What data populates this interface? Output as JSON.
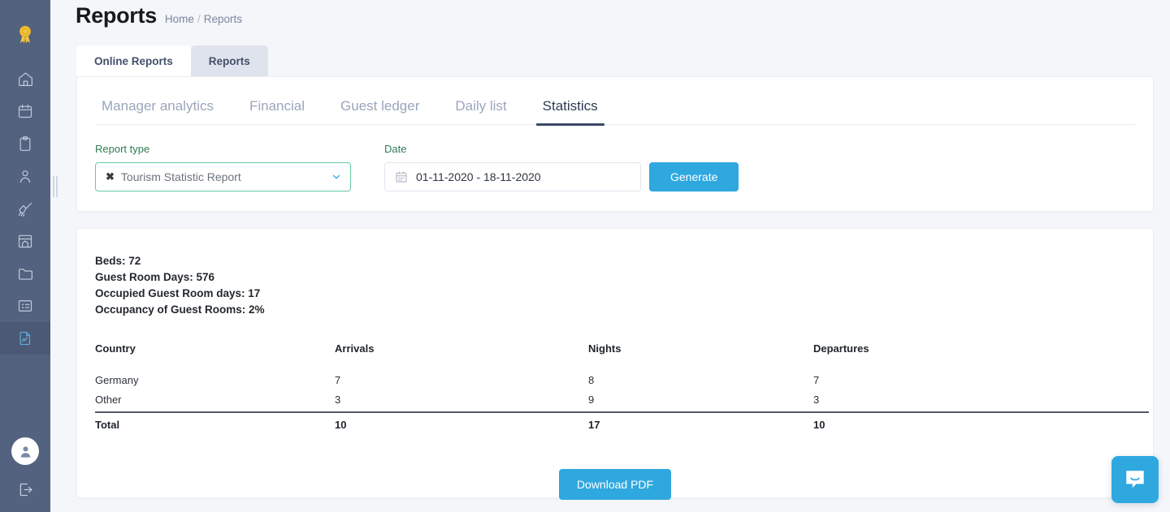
{
  "sidebar": {
    "logo_icon": "award-badge-icon",
    "items": [
      {
        "icon": "home-icon",
        "name": "sidebar-item-home",
        "active": false
      },
      {
        "icon": "calendar-icon",
        "name": "sidebar-item-calendar",
        "active": false
      },
      {
        "icon": "clipboard-icon",
        "name": "sidebar-item-clipboard",
        "active": false
      },
      {
        "icon": "user-icon",
        "name": "sidebar-item-guests",
        "active": false
      },
      {
        "icon": "broom-icon",
        "name": "sidebar-item-housekeeping",
        "active": false
      },
      {
        "icon": "window-icon",
        "name": "sidebar-item-rooms",
        "active": false
      },
      {
        "icon": "folder-icon",
        "name": "sidebar-item-files",
        "active": false
      },
      {
        "icon": "board-icon",
        "name": "sidebar-item-board",
        "active": false
      },
      {
        "icon": "report-chart-icon",
        "name": "sidebar-item-reports",
        "active": true
      }
    ],
    "avatar_icon": "user-avatar-icon",
    "logout_icon": "logout-icon"
  },
  "header": {
    "title": "Reports",
    "breadcrumb": {
      "home": "Home",
      "separator": "/",
      "current": "Reports"
    }
  },
  "outer_tabs": [
    {
      "label": "Online Reports",
      "active": true
    },
    {
      "label": "Reports",
      "active": false
    }
  ],
  "inner_tabs": [
    {
      "label": "Manager analytics",
      "active": false
    },
    {
      "label": "Financial",
      "active": false
    },
    {
      "label": "Guest ledger",
      "active": false
    },
    {
      "label": "Daily list",
      "active": false
    },
    {
      "label": "Statistics",
      "active": true
    }
  ],
  "form": {
    "report_type": {
      "label": "Report type",
      "value": "Tourism Statistic Report",
      "clear_icon": "close-x-icon",
      "chevron_icon": "chevron-down-icon"
    },
    "date": {
      "label": "Date",
      "value": "01-11-2020 - 18-11-2020",
      "calendar_icon": "calendar-icon"
    },
    "generate_label": "Generate"
  },
  "report": {
    "summary": [
      "Beds: 72",
      "Guest Room Days: 576",
      "Occupied Guest Room days: 17",
      "Occupancy of Guest Rooms: 2%"
    ],
    "table": {
      "columns": [
        "Country",
        "Arrivals",
        "Nights",
        "Departures"
      ],
      "rows": [
        {
          "country": "Germany",
          "arrivals": "7",
          "nights": "8",
          "departures": "7"
        },
        {
          "country": "Other",
          "arrivals": "3",
          "nights": "9",
          "departures": "3"
        }
      ],
      "total": {
        "country": "Total",
        "arrivals": "10",
        "nights": "17",
        "departures": "10"
      }
    },
    "download_label": "Download PDF"
  },
  "chat": {
    "icon": "chat-bubble-icon"
  },
  "colors": {
    "sidebar_bg": "#53627f",
    "accent_blue": "#2fa8e0",
    "label_green": "#2e7d52",
    "select_border_green": "#66c9a4",
    "active_tab_underline": "#3c4a66",
    "page_bg": "#f4f6fa"
  }
}
